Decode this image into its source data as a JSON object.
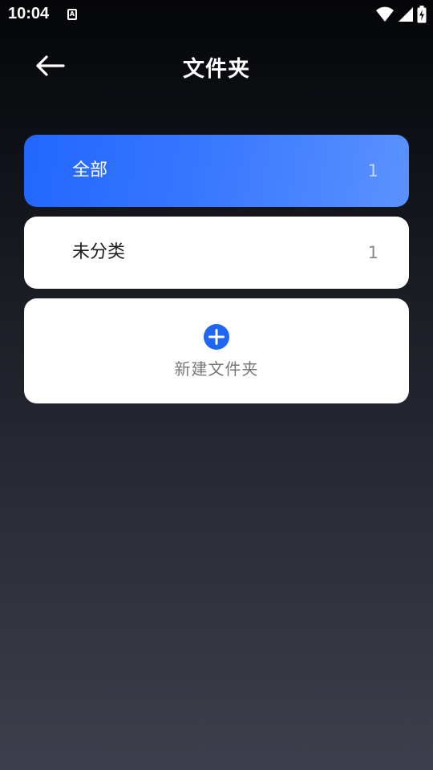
{
  "status_bar": {
    "time": "10:04",
    "notification_glyph": "A",
    "icons": [
      "wifi-icon",
      "cellular-signal-icon",
      "battery-charging-icon"
    ]
  },
  "header": {
    "back_icon": "arrow-left-icon",
    "title": "文件夹"
  },
  "folders": [
    {
      "label": "全部",
      "count": "1",
      "selected": true
    },
    {
      "label": "未分类",
      "count": "1",
      "selected": false
    }
  ],
  "new_folder": {
    "icon": "plus-circle-icon",
    "label": "新建文件夹"
  },
  "colors": {
    "accent": "#2266ff",
    "accent_light": "#5a92ff",
    "card_bg": "#ffffff",
    "background_top": "#050608",
    "background_bottom": "#3d404c"
  }
}
